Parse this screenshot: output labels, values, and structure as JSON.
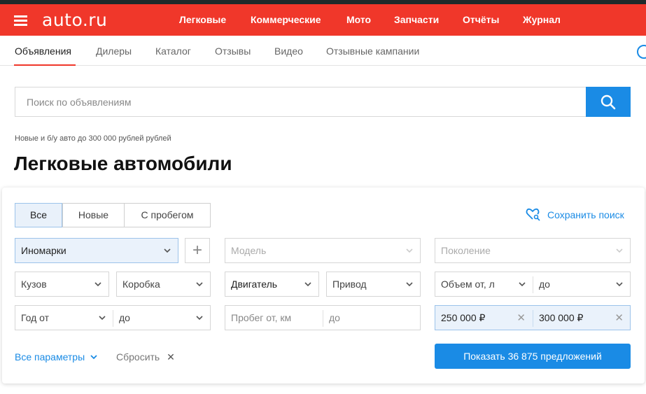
{
  "header": {
    "logo": "auto.ru",
    "nav": [
      "Легковые",
      "Коммерческие",
      "Мото",
      "Запчасти",
      "Отчёты",
      "Журнал"
    ],
    "brand_color": "#f0372a"
  },
  "subnav": {
    "items": [
      "Объявления",
      "Дилеры",
      "Каталог",
      "Отзывы",
      "Видео",
      "Отзывные кампании"
    ],
    "active": "Объявления"
  },
  "search": {
    "placeholder": "Поиск по объявлениям",
    "icon": "search-icon"
  },
  "breadcrumb": "Новые и б/у авто до 300 000 рублей рублей",
  "page_title": "Легковые автомобили",
  "filters": {
    "segments": [
      "Все",
      "Новые",
      "С пробегом"
    ],
    "selected_segment": "Все",
    "save_search": "Сохранить поиск",
    "brand": "Иномарки",
    "add_label": "+",
    "model_placeholder": "Модель",
    "generation_placeholder": "Поколение",
    "body": "Кузов",
    "gearbox": "Коробка",
    "engine": "Двигатель",
    "drive": "Привод",
    "volume_from": "Объем от, л",
    "volume_to": "до",
    "year_from": "Год от",
    "year_to": "до",
    "mileage_from": "Пробег от, км",
    "mileage_to": "до",
    "price_from": "250 000 ₽",
    "price_to": "300 000 ₽",
    "all_params": "Все параметры",
    "reset": "Сбросить",
    "show_button": "Показать 36 875 предложений",
    "accent_color": "#1a8be5"
  }
}
